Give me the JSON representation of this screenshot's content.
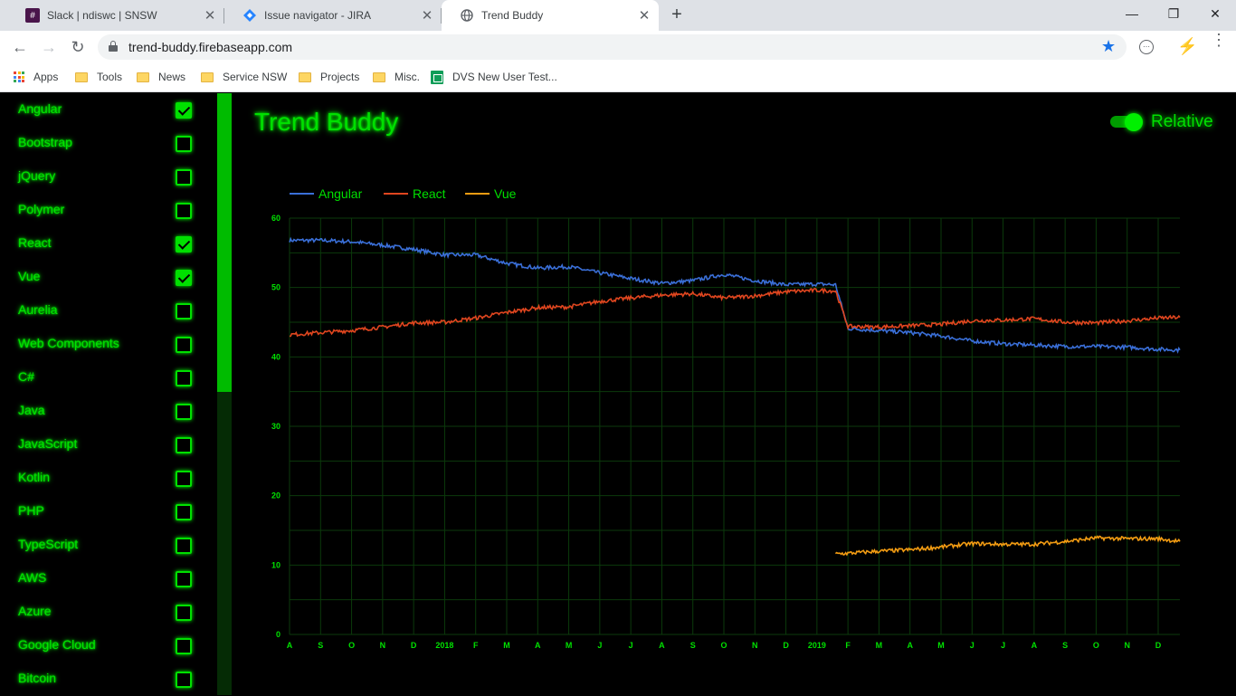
{
  "browser": {
    "tabs": [
      {
        "title": "Slack | ndiswc | SNSW",
        "icon": "slack-icon",
        "active": false
      },
      {
        "title": "Issue navigator - JIRA",
        "icon": "jira-icon",
        "active": false
      },
      {
        "title": "Trend Buddy",
        "icon": "globe-icon",
        "active": true
      }
    ],
    "url": "trend-buddy.firebaseapp.com",
    "bookmarks": [
      {
        "label": "Apps",
        "icon": "apps-grid-icon"
      },
      {
        "label": "Tools",
        "icon": "folder-icon"
      },
      {
        "label": "News",
        "icon": "folder-icon"
      },
      {
        "label": "Service NSW",
        "icon": "folder-icon"
      },
      {
        "label": "Projects",
        "icon": "folder-icon"
      },
      {
        "label": "Misc.",
        "icon": "folder-icon"
      },
      {
        "label": "DVS New User Test...",
        "icon": "google-sheets-icon"
      }
    ]
  },
  "app": {
    "title": "Trend Buddy",
    "toggle_label": "Relative",
    "toggle_on": true,
    "accent_color": "#00e000"
  },
  "sidebar": {
    "items": [
      {
        "label": "Angular",
        "checked": true
      },
      {
        "label": "Bootstrap",
        "checked": false
      },
      {
        "label": "jQuery",
        "checked": false
      },
      {
        "label": "Polymer",
        "checked": false
      },
      {
        "label": "React",
        "checked": true
      },
      {
        "label": "Vue",
        "checked": true
      },
      {
        "label": "Aurelia",
        "checked": false
      },
      {
        "label": "Web Components",
        "checked": false
      },
      {
        "label": "C#",
        "checked": false
      },
      {
        "label": "Java",
        "checked": false
      },
      {
        "label": "JavaScript",
        "checked": false
      },
      {
        "label": "Kotlin",
        "checked": false
      },
      {
        "label": "PHP",
        "checked": false
      },
      {
        "label": "TypeScript",
        "checked": false
      },
      {
        "label": "AWS",
        "checked": false
      },
      {
        "label": "Azure",
        "checked": false
      },
      {
        "label": "Google Cloud",
        "checked": false
      },
      {
        "label": "Bitcoin",
        "checked": false
      }
    ]
  },
  "chart_data": {
    "type": "line",
    "title": "",
    "xlabel": "",
    "ylabel": "",
    "ylim": [
      0,
      60
    ],
    "yticks": [
      0,
      10,
      20,
      30,
      40,
      50,
      60
    ],
    "xlim": [
      0,
      28.7
    ],
    "xticks": [
      "A",
      "S",
      "O",
      "N",
      "D",
      "2018",
      "F",
      "M",
      "A",
      "M",
      "J",
      "J",
      "A",
      "S",
      "O",
      "N",
      "D",
      "2019",
      "F",
      "M",
      "A",
      "M",
      "J",
      "J",
      "A",
      "S",
      "O",
      "N",
      "D"
    ],
    "grid": true,
    "legend_position": "top-left",
    "series": [
      {
        "name": "Angular",
        "color": "#3a6fd8",
        "x": [
          0,
          1,
          2,
          3,
          4,
          5,
          6,
          7,
          8,
          9,
          10,
          11,
          12,
          13,
          14,
          15,
          16,
          17,
          17.6,
          18,
          19,
          20,
          21,
          22,
          23,
          24,
          25,
          26,
          27,
          28,
          28.7
        ],
        "y": [
          56.8,
          56.8,
          56.6,
          56.1,
          55.5,
          54.7,
          54.7,
          53.5,
          52.8,
          53.0,
          52.1,
          51.3,
          50.6,
          51.0,
          51.9,
          51.0,
          50.4,
          50.5,
          50.4,
          44.1,
          43.8,
          43.5,
          43.0,
          42.3,
          41.9,
          41.7,
          41.5,
          41.5,
          41.4,
          41.1,
          41.0
        ]
      },
      {
        "name": "React",
        "color": "#e0461f",
        "x": [
          0,
          1,
          2,
          3,
          4,
          5,
          6,
          7,
          8,
          9,
          10,
          11,
          12,
          13,
          14,
          15,
          16,
          17,
          17.6,
          18,
          19,
          20,
          21,
          22,
          23,
          24,
          25,
          26,
          27,
          28,
          28.7
        ],
        "y": [
          43.2,
          43.5,
          43.8,
          44.3,
          44.9,
          45.0,
          45.6,
          46.4,
          47.1,
          47.2,
          48.0,
          48.5,
          48.9,
          49.1,
          48.5,
          48.8,
          49.4,
          49.6,
          49.5,
          44.4,
          44.3,
          44.5,
          44.7,
          45.2,
          45.3,
          45.5,
          45.0,
          44.9,
          45.2,
          45.6,
          45.7
        ]
      },
      {
        "name": "Vue",
        "color": "#f39c12",
        "x": [
          17.6,
          18,
          19,
          20,
          21,
          22,
          23,
          24,
          25,
          26,
          27,
          28,
          28.7
        ],
        "y": [
          11.6,
          11.7,
          12.0,
          12.2,
          12.6,
          13.1,
          13.0,
          13.0,
          13.4,
          13.9,
          13.8,
          13.8,
          13.4
        ]
      }
    ]
  }
}
